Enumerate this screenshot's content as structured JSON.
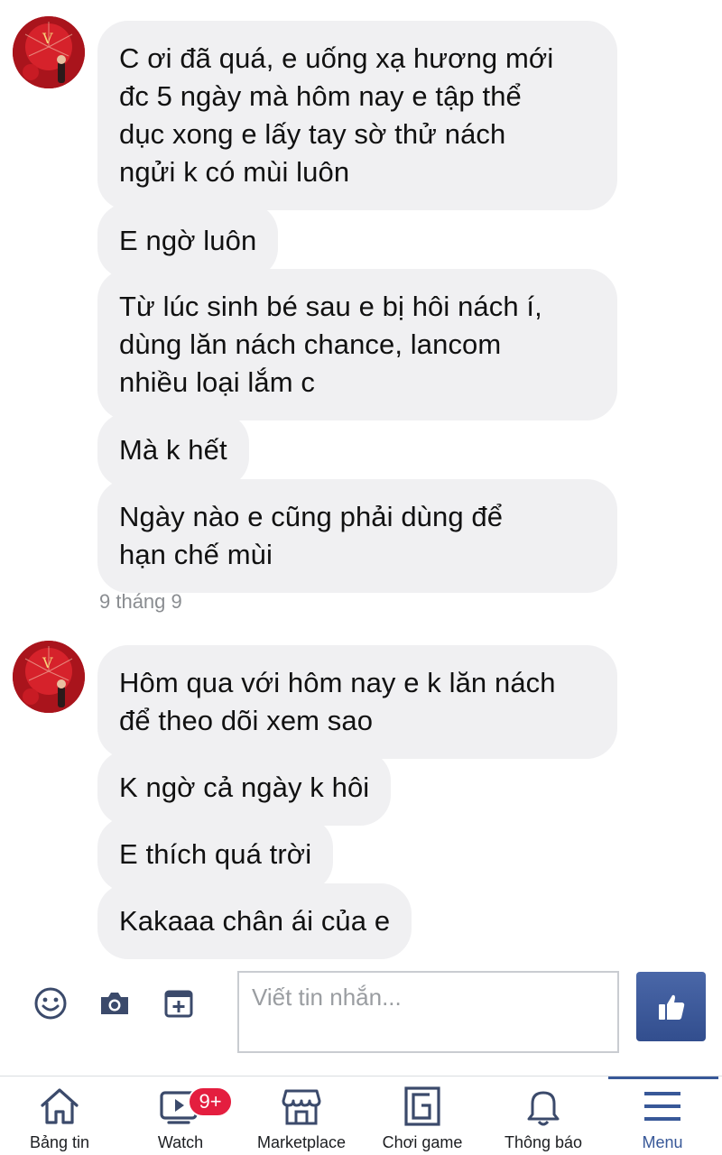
{
  "thread": {
    "messages_group1": [
      "C ơi đã quá, e uống xạ hương mới\nđc 5 ngày mà hôm nay e tập thể\ndục xong e lấy tay sờ thử nách\nngửi k có mùi luôn",
      "E ngờ luôn",
      "Từ lúc sinh bé sau e bị hôi nách í,\ndùng lăn nách chance, lancom\nnhiều loại lắm c",
      "Mà k hết",
      "Ngày nào e cũng phải dùng để\nhạn chế mùi"
    ],
    "date_separator": "9 tháng 9",
    "messages_group2": [
      "Hôm qua với hôm nay e k lăn nách\nđể theo dõi xem sao",
      "K ngờ cả ngày k hôi",
      "E thích quá trời",
      "Kakaaa chân ái của e"
    ]
  },
  "composer": {
    "emoji_icon": "smiley-icon",
    "camera_icon": "camera-icon",
    "gallery_icon": "add-photo-icon",
    "placeholder": "Viết tin nhắn...",
    "like_icon": "thumbs-up-icon"
  },
  "tabbar": {
    "items": [
      {
        "label": "Bảng tin",
        "icon": "home-icon"
      },
      {
        "label": "Watch",
        "icon": "watch-icon",
        "badge": "9+"
      },
      {
        "label": "Marketplace",
        "icon": "shop-icon"
      },
      {
        "label": "Chơi game",
        "icon": "game-icon"
      },
      {
        "label": "Thông báo",
        "icon": "bell-icon"
      },
      {
        "label": "Menu",
        "icon": "hamburger-icon",
        "active": true
      }
    ]
  },
  "colors": {
    "bubble": "#f0f0f2",
    "accent": "#385898",
    "badge": "#e41e3f"
  }
}
